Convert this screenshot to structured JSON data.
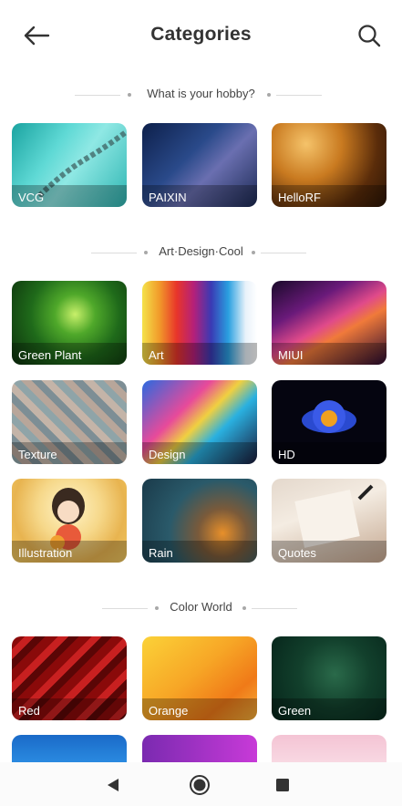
{
  "header": {
    "title": "Categories"
  },
  "sections": [
    {
      "title": "What is your hobby?",
      "tiles": [
        {
          "label": "VCG"
        },
        {
          "label": "PAIXIN"
        },
        {
          "label": "HelloRF"
        }
      ]
    },
    {
      "title": "Art·Design·Cool",
      "tiles": [
        {
          "label": "Green Plant"
        },
        {
          "label": "Art"
        },
        {
          "label": "MIUI"
        },
        {
          "label": "Texture"
        },
        {
          "label": "Design"
        },
        {
          "label": "HD"
        },
        {
          "label": "Illustration"
        },
        {
          "label": "Rain"
        },
        {
          "label": "Quotes"
        }
      ]
    },
    {
      "title": "Color World",
      "tiles": [
        {
          "label": "Red"
        },
        {
          "label": "Orange"
        },
        {
          "label": "Green"
        }
      ]
    }
  ],
  "icons": {
    "back": "arrow-left-icon",
    "search": "search-icon",
    "nav_back": "triangle-back-icon",
    "nav_home": "circle-home-icon",
    "nav_recents": "square-recents-icon"
  }
}
